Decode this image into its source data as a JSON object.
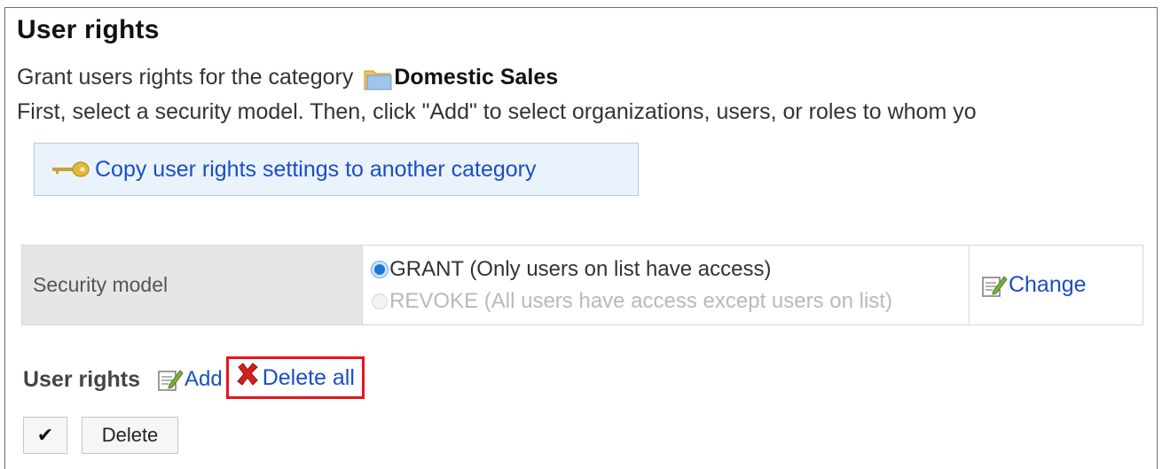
{
  "page": {
    "title": "User rights",
    "intro_text": "Grant users rights for the category ",
    "category_name": "Domestic Sales",
    "instructions": "First, select a security model. Then, click \"Add\" to select organizations, users, or roles to whom yo"
  },
  "copy_button": {
    "label": "Copy user rights settings to another category",
    "icon": "key-icon"
  },
  "security_model": {
    "label": "Security model",
    "options": [
      {
        "label": "GRANT (Only users on list have access)",
        "selected": true,
        "enabled": true
      },
      {
        "label": "REVOKE (All users have access except users on list)",
        "selected": false,
        "enabled": false
      }
    ],
    "change_label": "Change",
    "change_icon": "edit-icon"
  },
  "user_rights": {
    "heading": "User rights",
    "add_label": "Add",
    "add_icon": "edit-icon",
    "delete_all_label": "Delete all",
    "delete_all_icon": "x-icon",
    "highlight_color": "#e8141c"
  },
  "actions": {
    "check_all_symbol": "✔",
    "delete_label": "Delete"
  },
  "colors": {
    "link": "#1a4fc3",
    "button_bg": "#eaf2fb",
    "label_cell_bg": "#e6e6e6"
  }
}
